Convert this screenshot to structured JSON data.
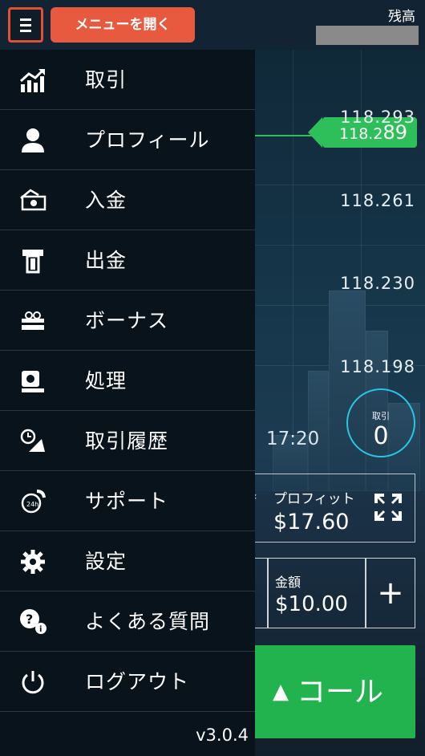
{
  "topbar": {
    "menu_label": "メニューを開く",
    "balance_label": "残高"
  },
  "menu": {
    "items": [
      {
        "label": "取引",
        "icon": "chart-up-icon"
      },
      {
        "label": "プロフィール",
        "icon": "user-icon"
      },
      {
        "label": "入金",
        "icon": "deposit-icon"
      },
      {
        "label": "出金",
        "icon": "withdraw-icon"
      },
      {
        "label": "ボーナス",
        "icon": "bonus-icon"
      },
      {
        "label": "処理",
        "icon": "process-icon"
      },
      {
        "label": "取引履歴",
        "icon": "history-icon"
      },
      {
        "label": "サポート",
        "icon": "support-icon"
      },
      {
        "label": "設定",
        "icon": "gear-icon"
      },
      {
        "label": "よくある質問",
        "icon": "faq-icon"
      },
      {
        "label": "ログアウト",
        "icon": "power-icon"
      }
    ],
    "version": "v3.0.4"
  },
  "chart": {
    "current_price_prefix": "118.2",
    "current_price_suffix": "89",
    "axis_labels": [
      "118.293",
      "118.261",
      "118.230",
      "118.198"
    ],
    "time_label": "17:20"
  },
  "trade": {
    "trades_label": "取引",
    "trades_count": "0",
    "profit_label": "プロフィット",
    "profit_value": "$17.60",
    "amount_label": "金額",
    "amount_value": "$10.00",
    "plus": "+",
    "call_label": "コール",
    "call_arrow": "▲"
  },
  "colors": {
    "accent": "#e75a3f",
    "green": "#23b34e",
    "menu_bg": "#08131b",
    "cyan": "#28c6e6"
  }
}
